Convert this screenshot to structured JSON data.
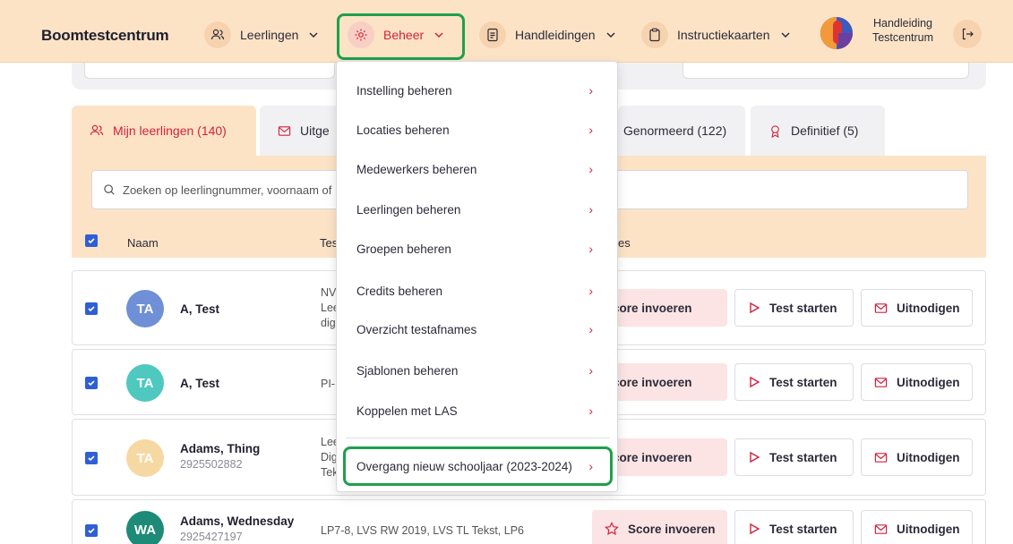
{
  "brand": "Boomtestcentrum",
  "nav": {
    "leerlingen": "Leerlingen",
    "beheer": "Beheer",
    "handleidingen": "Handleidingen",
    "instructiekaarten": "Instructiekaarten",
    "handleiding_line1": "Handleiding",
    "handleiding_line2": "Testcentrum"
  },
  "tabs": {
    "mijn": "Mijn leerlingen (140)",
    "uitgenodigd": "Uitge",
    "genormeerd": "Genormeerd (122)",
    "definitief": "Definitief (5)"
  },
  "search": {
    "placeholder": "Zoeken op leerlingnummer, voornaam of"
  },
  "table_header": {
    "naam": "Naam",
    "tests": "Tes",
    "extra": "es"
  },
  "rows": [
    {
      "initials": "TA",
      "name": "A, Test",
      "number": "",
      "tests_lines": [
        "NVI",
        "Lee",
        "digi"
      ],
      "avatar_color": "#6f8fd6"
    },
    {
      "initials": "TA",
      "name": "A, Test",
      "number": "",
      "tests_lines": [
        "PI-I"
      ],
      "avatar_color": "#4fc8c0"
    },
    {
      "initials": "TA",
      "name": "Adams, Thing",
      "number": "2925502882",
      "tests_lines": [
        "Lee",
        "Dig",
        "Tek"
      ],
      "avatar_color": "#f6d9a2"
    },
    {
      "initials": "WA",
      "name": "Adams, Wednesday",
      "number": "2925427197",
      "tests_lines": [
        "LP7-8, LVS RW 2019, LVS TL Tekst, LP6"
      ],
      "avatar_color": "#1e8a78"
    }
  ],
  "buttons": {
    "score": "Score invoeren",
    "test": "Test starten",
    "invite": "Uitnodigen"
  },
  "dropdown": [
    "Instelling beheren",
    "Locaties beheren",
    "Medewerkers beheren",
    "Leerlingen beheren",
    "Groepen beheren",
    "Credits beheren",
    "Overzicht testafnames",
    "Sjablonen beheren",
    "Koppelen met LAS",
    "Overgang nieuw schooljaar (2023-2024)"
  ],
  "colors": {
    "accent": "#d4213d",
    "nav_bg": "#fde3c6",
    "checkbox": "#2f5fd6",
    "highlight": "#1ea04a"
  }
}
